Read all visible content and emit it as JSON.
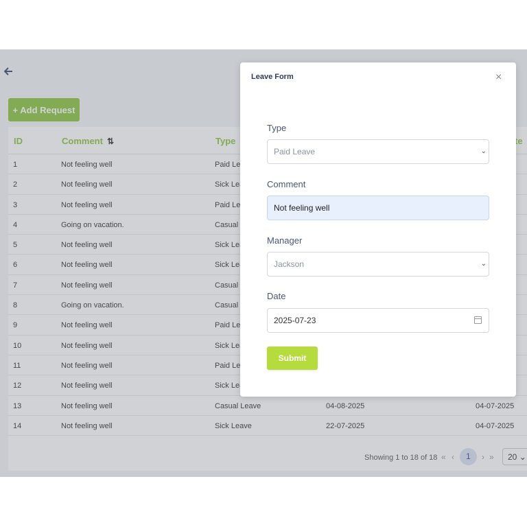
{
  "toolbar": {
    "add_request_label": "+ Add Request"
  },
  "table": {
    "columns": [
      "ID",
      "Comment",
      "Type",
      "te"
    ],
    "rows": [
      {
        "id": "1",
        "comment": "Not feeling well",
        "type": "Paid Lea",
        "date1": "",
        "date2": ""
      },
      {
        "id": "2",
        "comment": "Not feeling well",
        "type": "Sick Lea",
        "date1": "",
        "date2": ""
      },
      {
        "id": "3",
        "comment": "Not feeling well",
        "type": "Paid Lea",
        "date1": "",
        "date2": ""
      },
      {
        "id": "4",
        "comment": "Going on vacation.",
        "type": "Casual L",
        "date1": "",
        "date2": ""
      },
      {
        "id": "5",
        "comment": "Not feeling well",
        "type": "Sick Lea",
        "date1": "",
        "date2": ""
      },
      {
        "id": "6",
        "comment": "Not feeling well",
        "type": "Sick Lea",
        "date1": "",
        "date2": ""
      },
      {
        "id": "7",
        "comment": "Not feeling well",
        "type": "Casual L",
        "date1": "",
        "date2": ""
      },
      {
        "id": "8",
        "comment": "Going on vacation.",
        "type": "Casual L",
        "date1": "",
        "date2": ""
      },
      {
        "id": "9",
        "comment": "Not feeling well",
        "type": "Paid Lea",
        "date1": "",
        "date2": ""
      },
      {
        "id": "10",
        "comment": "Not feeling well",
        "type": "Sick Lea",
        "date1": "",
        "date2": ""
      },
      {
        "id": "11",
        "comment": "Not feeling well",
        "type": "Paid Lea",
        "date1": "",
        "date2": ""
      },
      {
        "id": "12",
        "comment": "Not feeling well",
        "type": "Sick Lea",
        "date1": "",
        "date2": ""
      },
      {
        "id": "13",
        "comment": "Not feeling well",
        "type": "Casual Leave",
        "date1": "04-08-2025",
        "date2": "04-07-2025"
      },
      {
        "id": "14",
        "comment": "Not feeling well",
        "type": "Sick Leave",
        "date1": "22-07-2025",
        "date2": "04-07-2025"
      }
    ]
  },
  "pagination": {
    "summary": "Showing 1 to 18 of 18",
    "current_page": "1",
    "page_size": "20"
  },
  "modal": {
    "title": "Leave Form",
    "close": "×",
    "type_label": "Type",
    "type_value": "Paid Leave",
    "comment_label": "Comment",
    "comment_value": "Not feeling well",
    "manager_label": "Manager",
    "manager_value": "Jackson",
    "date_label": "Date",
    "date_value": "2025-07-23",
    "submit_label": "Submit"
  },
  "icons": {
    "back": "arrow-left-icon",
    "sort": "sort-icon",
    "calendar": "calendar-icon"
  },
  "colors": {
    "accent": "#8cc63f",
    "submit": "#b5dc3c",
    "pager_active": "#dbe2f4"
  }
}
